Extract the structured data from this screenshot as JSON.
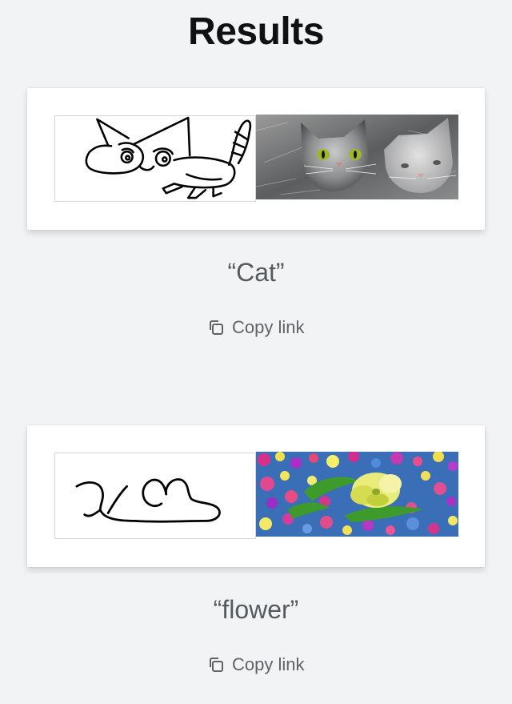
{
  "page": {
    "title": "Results"
  },
  "results": [
    {
      "caption": "“Cat”",
      "sketch_alt": "hand-drawn cat sketch",
      "photo_alt": "generated photo of two grey cats",
      "copy_label": "Copy link",
      "copy_icon": "copy-icon"
    },
    {
      "caption": "“flower”",
      "sketch_alt": "hand-drawn flower scribble",
      "photo_alt": "generated photo of colorful flowers",
      "copy_label": "Copy link",
      "copy_icon": "copy-icon"
    }
  ],
  "colors": {
    "background": "#f2f3f5",
    "card": "#ffffff",
    "caption_text": "#555a5f",
    "link_text": "#5f6368"
  }
}
